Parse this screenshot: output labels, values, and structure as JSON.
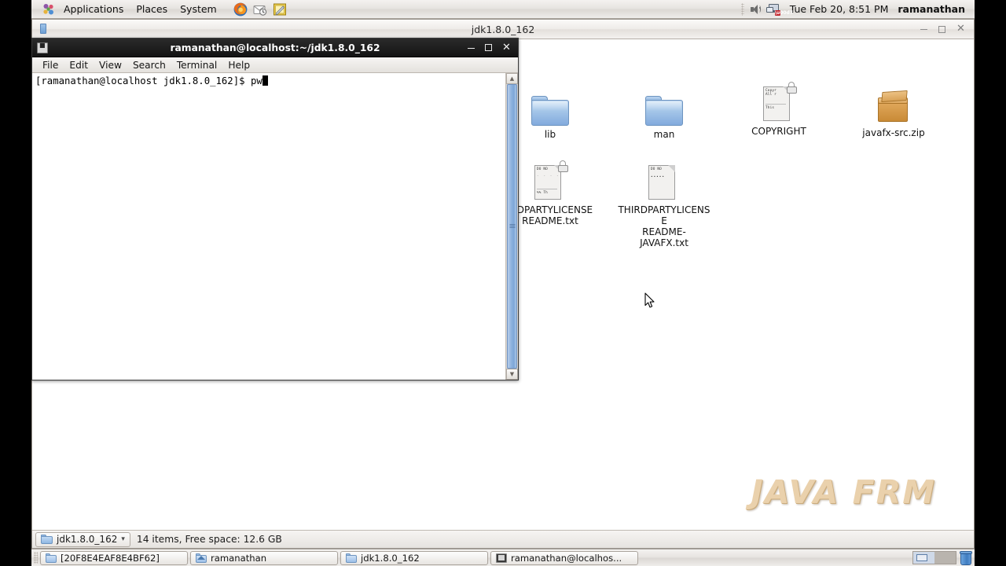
{
  "panel": {
    "menus": [
      "Applications",
      "Places",
      "System"
    ],
    "apps_icon": "applications-menu-icon",
    "launchers": [
      {
        "name": "firefox-launcher-icon",
        "title": "Firefox Web Browser"
      },
      {
        "name": "evolution-mail-launcher-icon",
        "title": "Evolution Mail"
      },
      {
        "name": "text-editor-launcher-icon",
        "title": "Text Editor"
      }
    ],
    "tray": {
      "volume_icon": "speaker-volume-icon",
      "network_icon": "network-disconnected-icon"
    },
    "clock": "Tue Feb 20,  8:51 PM",
    "user": "ramanathan"
  },
  "file_manager": {
    "title": "jdk1.8.0_162",
    "window_icon": "file-manager-icon",
    "controls": {
      "minimize": "–",
      "maximize": "□",
      "close": "✕"
    },
    "items": [
      {
        "label": "lib",
        "type": "folder",
        "icon": "folder-icon",
        "locked": false,
        "preview": []
      },
      {
        "label": "man",
        "type": "folder",
        "icon": "folder-icon",
        "locked": false,
        "preview": []
      },
      {
        "label": "COPYRIGHT",
        "type": "text-document",
        "icon": "text-document-icon",
        "locked": true,
        "preview": [
          "Copyr",
          "All r",
          "",
          "This"
        ]
      },
      {
        "label": "javafx-src.zip",
        "type": "archive",
        "icon": "archive-icon",
        "locked": false,
        "preview": []
      },
      {
        "label": "THIRDPARTYLICENSEREADME.txt",
        "display_label": "IRDPARTYLICENSE\nREADME.txt",
        "type": "text-document",
        "icon": "text-document-icon",
        "locked": true,
        "preview": [
          "DO NO",
          "- - - -",
          "",
          "%% Th"
        ]
      },
      {
        "label": "THIRDPARTYLICENSEREADME-JAVAFX.txt",
        "display_label": "THIRDPARTYLICENSE\nREADME-JAVAFX.txt",
        "type": "text-document",
        "icon": "text-document-icon",
        "locked": false,
        "preview": [
          "DO NO",
          "• • • • •"
        ]
      }
    ],
    "status": {
      "path_button": "jdk1.8.0_162",
      "path_icon": "folder-icon",
      "caret": "▾",
      "info": "14 items, Free space: 12.6 GB"
    }
  },
  "terminal": {
    "title": "ramanathan@localhost:~/jdk1.8.0_162",
    "window_icon": "terminal-icon",
    "controls": {
      "minimize": "–",
      "maximize": "□",
      "close": "✕"
    },
    "menus": [
      "File",
      "Edit",
      "View",
      "Search",
      "Terminal",
      "Help"
    ],
    "prompt": "[ramanathan@localhost jdk1.8.0_162]$ ",
    "typed_command": "pw",
    "scrollbar": {
      "up": "▲",
      "down": "▼"
    }
  },
  "watermark": "JAVA FRM",
  "taskbar": {
    "buttons": [
      {
        "label": "[20F8E4EAF8E4BF62]",
        "icon": "folder-icon"
      },
      {
        "label": "ramanathan",
        "icon": "home-folder-icon"
      },
      {
        "label": "jdk1.8.0_162",
        "icon": "folder-icon"
      },
      {
        "label": "ramanathan@localhos...",
        "icon": "terminal-icon"
      }
    ],
    "workspaces": 2,
    "active_workspace": 1,
    "trash_icon": "trash-icon"
  },
  "colors": {
    "panel_bg": "#e7e4e1",
    "folder_blue": "#8fb6e0",
    "archive_orange": "#d9a257",
    "terminal_titlebar": "#131313",
    "scrollbar_blue": "#8fb3df",
    "watermark": "#e9cfa8",
    "desktop_black": "#000000"
  }
}
